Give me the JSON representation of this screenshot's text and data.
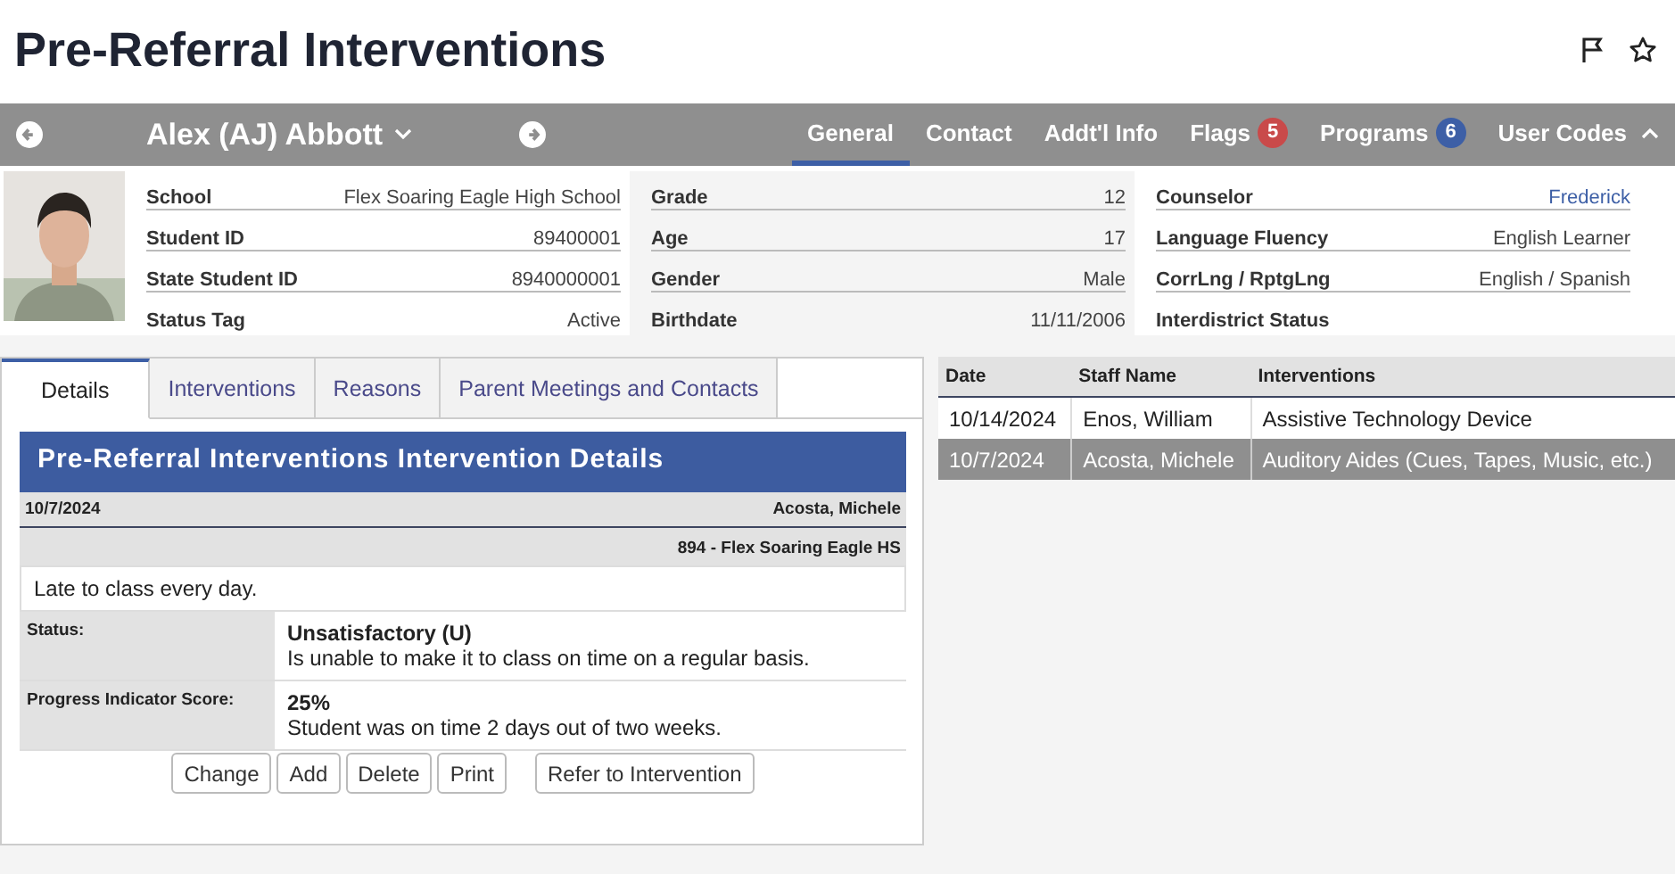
{
  "page": {
    "title": "Pre-Referral Interventions"
  },
  "student_bar": {
    "name": "Alex (AJ) Abbott",
    "tabs": [
      {
        "label": "General",
        "selected": true
      },
      {
        "label": "Contact",
        "selected": false
      },
      {
        "label": "Addt'l Info",
        "selected": false
      },
      {
        "label": "Flags",
        "selected": false,
        "badge": "5",
        "color": "#c94a4a"
      },
      {
        "label": "Programs",
        "selected": false,
        "badge": "6",
        "color": "#3d5fa6"
      },
      {
        "label": "User Codes",
        "selected": false,
        "expanded": true
      }
    ]
  },
  "student_info": {
    "columns": [
      [
        {
          "label": "School",
          "value": "Flex Soaring Eagle High School"
        },
        {
          "label": "Student ID",
          "value": "89400001"
        },
        {
          "label": "State Student ID",
          "value": "8940000001"
        },
        {
          "label": "Status Tag",
          "value": "Active"
        }
      ],
      [
        {
          "label": "Grade",
          "value": "12"
        },
        {
          "label": "Age",
          "value": "17"
        },
        {
          "label": "Gender",
          "value": "Male"
        },
        {
          "label": "Birthdate",
          "value": "11/11/2006"
        }
      ],
      [
        {
          "label": "Counselor",
          "value": "Frederick",
          "kind": "link"
        },
        {
          "label": "Language Fluency",
          "value": "English Learner"
        },
        {
          "label": "CorrLng / RptgLng",
          "value": "English / Spanish"
        },
        {
          "label": "Interdistrict Status"
        }
      ]
    ]
  },
  "detail_tabs": [
    {
      "label": "Details",
      "selected": true
    },
    {
      "label": "Interventions",
      "selected": false
    },
    {
      "label": "Reasons",
      "selected": false
    },
    {
      "label": "Parent Meetings and Contacts",
      "selected": false
    }
  ],
  "details": {
    "title": "Pre-Referral Interventions Intervention Details",
    "date": "10/7/2024",
    "staff": "Acosta, Michele",
    "school": "894 - Flex Soaring Eagle HS",
    "description": "Late to class every day.",
    "fields": [
      {
        "label": "Status:",
        "value": "Unsatisfactory (U)",
        "note": "Is unable to make it to class on time on a regular basis."
      },
      {
        "label": "Progress Indicator Score:",
        "value": "25%",
        "note": "Student was on time 2 days out of two weeks."
      }
    ],
    "buttons": [
      "Change",
      "Add",
      "Delete",
      "Print",
      "Refer to Intervention"
    ]
  },
  "history": {
    "columns": [
      "Date",
      "Staff Name",
      "Interventions"
    ],
    "rows": [
      {
        "cells": [
          "10/14/2024",
          "Enos, William",
          "Assistive Technology Device"
        ],
        "selected": false
      },
      {
        "cells": [
          "10/7/2024",
          "Acosta, Michele",
          "Auditory Aides (Cues, Tapes, Music, etc.)"
        ],
        "selected": true
      }
    ]
  }
}
